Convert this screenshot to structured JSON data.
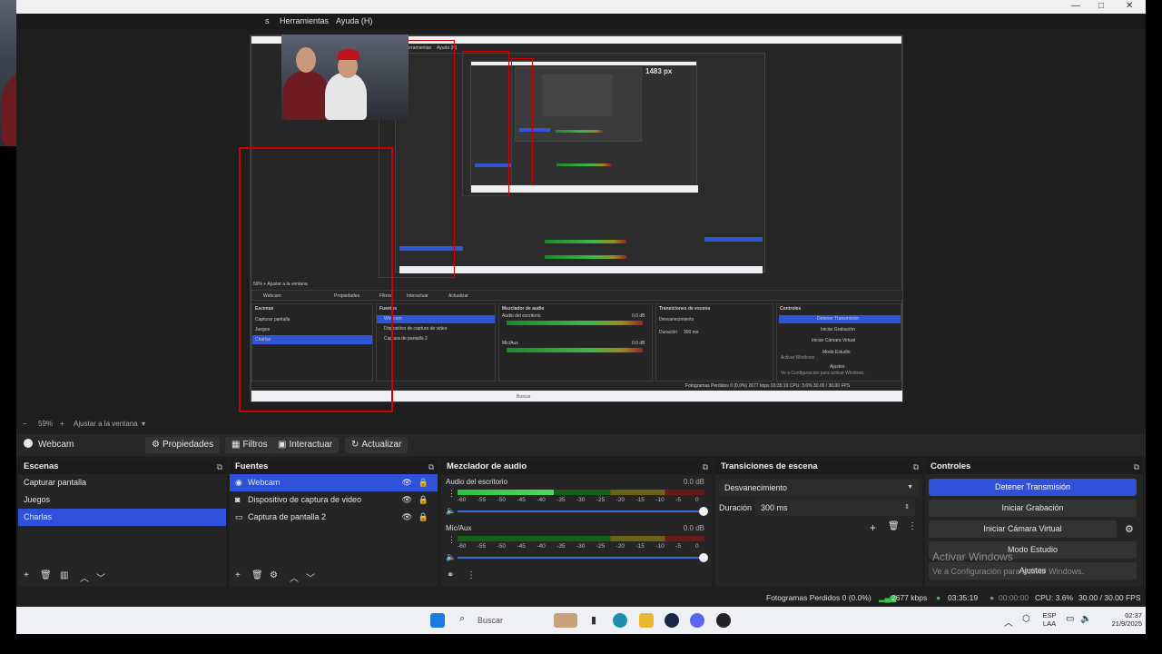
{
  "menu": {
    "partial": "s",
    "tools": "Herramientas",
    "help": "Ayuda (H)"
  },
  "window_controls": {
    "minimize": "—",
    "maximize": "□",
    "close": "✕"
  },
  "preview": {
    "nested_menu_tools": "Herramientas",
    "nested_menu_help": "Ayuda (H)",
    "size_label": "1483 px",
    "nested_activate": "Activar Windows",
    "nested_activate_sub": "Ve a Configuración para activar Windows.",
    "nested_stats": "Fotogramas Perdidos 0 (0.0%)   2677 kbps   03:35:19   CPU: 3.6%   30.00 / 30.00 FPS",
    "nested_search": "Buscar",
    "nested_scenes_title": "Escenas",
    "nested_sources_title": "Fuentes",
    "nested_mixer_title": "Mezclador de audio",
    "nested_transitions_title": "Transiciones de escena",
    "nested_controls_title": "Controles",
    "nested_scenes": [
      "Capturar pantalla",
      "Juegos",
      "Charlas"
    ],
    "nested_sources": [
      "Webcam",
      "Dispositivo de captura de video",
      "Captura de pantalla 2"
    ],
    "nested_controls": [
      "Detener Transmisión",
      "Iniciar Grabación",
      "Iniciar Cámara Virtual",
      "Modo Estudio",
      "Ajustes"
    ],
    "nested_toolbar": [
      "Webcam",
      "Propiedades",
      "Filtros",
      "Interactuar",
      "Actualizar"
    ],
    "nested_zoom": "59%  +  Ajustar a la ventana",
    "nested_transition": "Desvanecimiento",
    "nested_duration_label": "Duración",
    "nested_duration": "300 ms",
    "nested_audio_desktop": "Audio del escritorio",
    "nested_mic": "Mic/Aux",
    "nested_db": "0.0 dB"
  },
  "zoom": {
    "minus": "−",
    "percent": "59%",
    "plus": "+",
    "fit": "Ajustar a la ventana",
    "arrow": "▾"
  },
  "source_toolbar": {
    "selected_source": "Webcam",
    "properties": "Propiedades",
    "filters": "Filtros",
    "interact": "Interactuar",
    "refresh": "Actualizar"
  },
  "scenes": {
    "title": "Escenas",
    "items": [
      "Capturar pantalla",
      "Juegos",
      "Charlas"
    ],
    "selected_index": 2
  },
  "sources": {
    "title": "Fuentes",
    "items": [
      {
        "name": "Webcam",
        "type_icon": "camera-icon"
      },
      {
        "name": "Dispositivo de captura de video",
        "type_icon": "camera-icon"
      },
      {
        "name": "Captura de pantalla 2",
        "type_icon": "monitor-icon"
      }
    ],
    "selected_index": 0
  },
  "mixer": {
    "title": "Mezclador de audio",
    "channels": [
      {
        "name": "Audio del escritorio",
        "db": "0.0 dB",
        "level": 0.39
      },
      {
        "name": "Mic/Aux",
        "db": "0.0 dB",
        "level": 0.0
      }
    ],
    "scale": [
      "-60",
      "-55",
      "-50",
      "-45",
      "-40",
      "-35",
      "-30",
      "-25",
      "-20",
      "-15",
      "-10",
      "-5",
      "0"
    ]
  },
  "transitions": {
    "title": "Transiciones de escena",
    "selected": "Desvanecimiento",
    "duration_label": "Duración",
    "duration_value": "300 ms"
  },
  "controls": {
    "title": "Controles",
    "stop_stream": "Detener Transmisión",
    "start_record": "Iniciar Grabación",
    "start_virtual_cam": "Iniciar Cámara Virtual",
    "studio_mode": "Modo Estudio",
    "settings": "Ajustes"
  },
  "watermark": {
    "title": "Activar Windows",
    "subtitle": "Ve a Configuración para activar Windows."
  },
  "status": {
    "dropped_frames": "Fotogramas Perdidos 0 (0.0%)",
    "bitrate": "2677 kbps",
    "stream_time": "03:35:19",
    "record_time": "00:00:00",
    "cpu": "CPU: 3.6%",
    "fps": "30.00 / 30.00 FPS"
  },
  "taskbar": {
    "search_placeholder": "Buscar",
    "language": "ESP",
    "language_sub": "LAA",
    "time": "02:37",
    "date": "21/9/2025"
  },
  "colors": {
    "accent": "#2f50d8",
    "panel": "#252525",
    "background": "#1f1f1f",
    "red_outline": "#d10000",
    "meter_green": "#2fbf3f"
  }
}
